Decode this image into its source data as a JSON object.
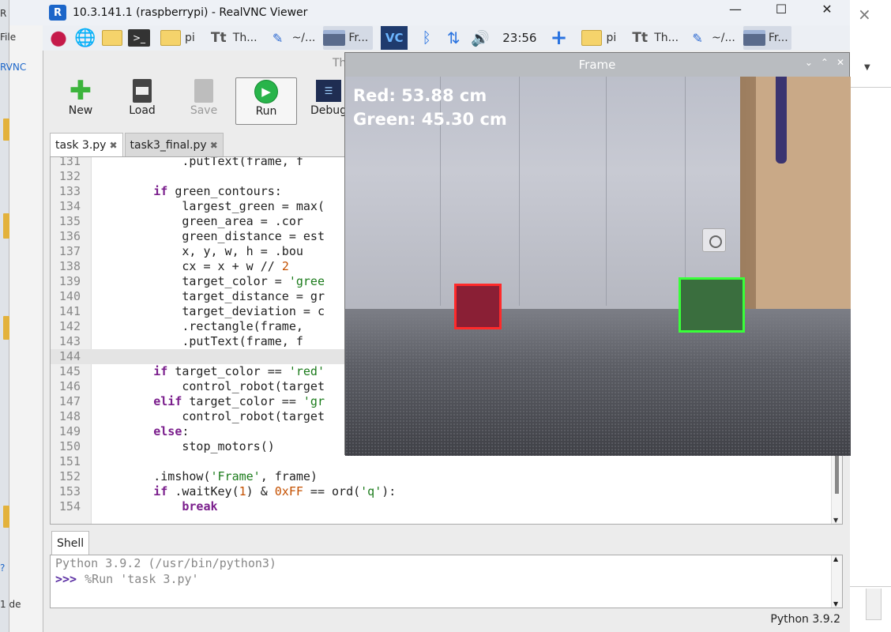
{
  "host": {
    "left_labels": [
      "R",
      "File",
      "RVNC"
    ],
    "status_text": "1 de",
    "help_icon": "question-icon"
  },
  "vnc": {
    "title": "10.3.141.1 (raspberrypi) - RealVNC Viewer",
    "logo": "R",
    "controls": {
      "minimize": "—",
      "maximize": "☐",
      "close": "✕"
    }
  },
  "taskbar": {
    "items": [
      {
        "icon": "raspberry-menu-icon"
      },
      {
        "icon": "web-browser-icon"
      },
      {
        "icon": "file-manager-icon"
      },
      {
        "icon": "terminal-icon",
        "glyph": ">_"
      },
      {
        "icon": "folder-icon",
        "label": "pi"
      },
      {
        "icon": "thonny-icon",
        "label": "Th..."
      },
      {
        "icon": "text-editor-icon",
        "label": "~/..."
      },
      {
        "icon": "window-icon",
        "label": "Fr..."
      }
    ],
    "tray": {
      "vnc_icon": "VC",
      "bluetooth_icon": "bluetooth-icon",
      "network_icon": "network-icon",
      "volume_icon": "volume-icon",
      "clock": "23:56"
    },
    "items_right": [
      {
        "icon": "folder-icon",
        "label": "pi"
      },
      {
        "icon": "thonny-icon",
        "label": "Th..."
      },
      {
        "icon": "text-editor-icon",
        "label": "~/..."
      },
      {
        "icon": "window-icon",
        "label": "Fr..."
      }
    ]
  },
  "thonny": {
    "title_partial": "Th",
    "toolbar": {
      "new": "New",
      "load": "Load",
      "save": "Save",
      "run": "Run",
      "debug": "Debug"
    },
    "tabs": [
      {
        "label": "task 3.py",
        "active": true
      },
      {
        "label": "task3_final.py",
        "active": false
      }
    ],
    "tab_close": "✖",
    "code_lines": [
      {
        "n": "131",
        "text": "            cv2.putText(frame, f"
      },
      {
        "n": "132",
        "text": ""
      },
      {
        "n": "133",
        "text": "        if green_contours:"
      },
      {
        "n": "134",
        "text": "            largest_green = max("
      },
      {
        "n": "135",
        "text": "            green_area = cv2.cor"
      },
      {
        "n": "136",
        "text": "            green_distance = est"
      },
      {
        "n": "137",
        "text": "            x, y, w, h = cv2.bou"
      },
      {
        "n": "138",
        "text": "            cx = x + w // 2"
      },
      {
        "n": "139",
        "text": "            target_color = 'gree"
      },
      {
        "n": "140",
        "text": "            target_distance = gr"
      },
      {
        "n": "141",
        "text": "            target_deviation = c"
      },
      {
        "n": "142",
        "text": "            cv2.rectangle(frame,"
      },
      {
        "n": "143",
        "text": "            cv2.putText(frame, f"
      },
      {
        "n": "144",
        "text": ""
      },
      {
        "n": "145",
        "text": "        if target_color == 'red'"
      },
      {
        "n": "146",
        "text": "            control_robot(target"
      },
      {
        "n": "147",
        "text": "        elif target_color == 'gr"
      },
      {
        "n": "148",
        "text": "            control_robot(target"
      },
      {
        "n": "149",
        "text": "        else:"
      },
      {
        "n": "150",
        "text": "            stop_motors()"
      },
      {
        "n": "151",
        "text": ""
      },
      {
        "n": "152",
        "text": "        cv2.imshow('Frame', frame)"
      },
      {
        "n": "153",
        "text": "        if cv2.waitKey(1) & 0xFF == ord('q'):"
      },
      {
        "n": "154",
        "text": "            break"
      }
    ],
    "shell": {
      "tab": "Shell",
      "banner": "Python 3.9.2 (/usr/bin/python3)",
      "prompt": ">>>",
      "command": "%Run 'task 3.py'"
    },
    "status": "Python 3.9.2"
  },
  "frame_window": {
    "title": "Frame",
    "controls": {
      "minimize": "⌄",
      "maximize": "⌃",
      "close": "✕"
    },
    "overlay": {
      "red_text": "Red: 53.88 cm",
      "green_text": "Green: 45.30 cm"
    },
    "colors": {
      "red_box": "#ff2a2a",
      "green_box": "#39ff39"
    }
  },
  "colors": {
    "thonny_bg": "#ececec",
    "run_green": "#28b44a",
    "keyword": "#7a1e8c",
    "string": "#1b7b1b",
    "number": "#c45000"
  }
}
